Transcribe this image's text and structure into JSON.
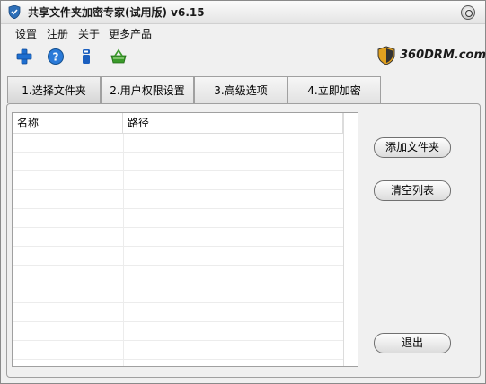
{
  "window": {
    "title": "共享文件夹加密专家(试用版) v6.15"
  },
  "menu": {
    "items": [
      "设置",
      "注册",
      "关于",
      "更多产品"
    ]
  },
  "toolbar": {
    "icons": [
      "plus-icon",
      "help-icon",
      "info-icon",
      "basket-icon"
    ],
    "colors": {
      "plus": "#1e6fd0",
      "help": "#2a7ad8",
      "info": "#1b5fbf",
      "basket": "#3a9a2a"
    }
  },
  "brand": {
    "text": "360DRM.com"
  },
  "tabs": [
    {
      "label": "1.选择文件夹",
      "active": true
    },
    {
      "label": "2.用户权限设置",
      "active": false
    },
    {
      "label": "3.高级选项",
      "active": false
    },
    {
      "label": "4.立即加密",
      "active": false
    }
  ],
  "table": {
    "columns": [
      "名称",
      "路径"
    ],
    "rows": []
  },
  "buttons": {
    "add_folder": "添加文件夹",
    "clear_list": "清空列表",
    "exit": "退出"
  }
}
